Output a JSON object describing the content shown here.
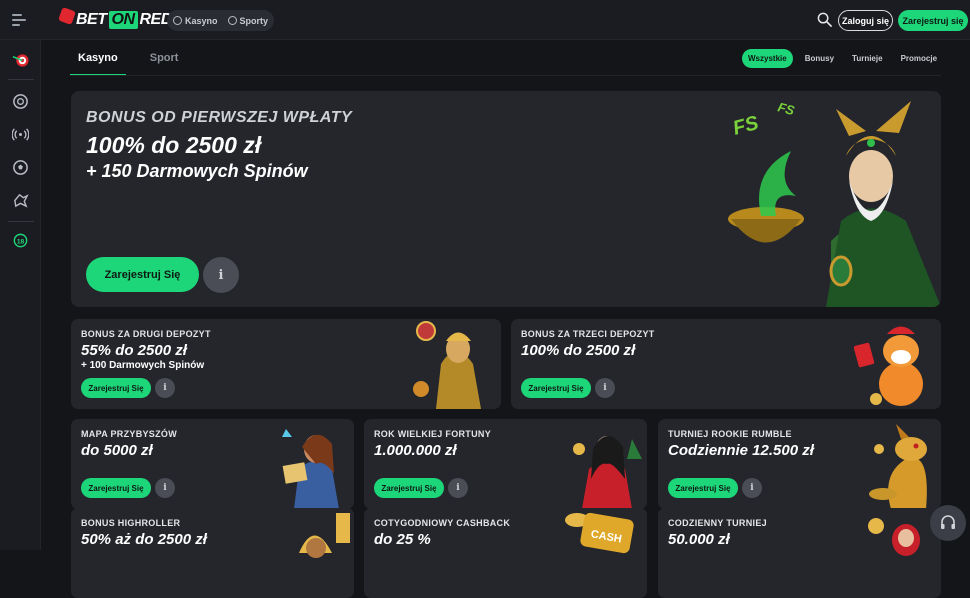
{
  "header": {
    "brand_left": "BET",
    "brand_mid": "ON",
    "brand_right": "RED",
    "nav": [
      {
        "label": "Kasyno",
        "icon": "casino-chip-icon"
      },
      {
        "label": "Sporty",
        "icon": "soccer-ball-icon"
      }
    ],
    "login_label": "Zaloguj się",
    "register_label": "Zarejestruj się"
  },
  "sidebar": {
    "icons": [
      "dart-target-icon",
      "casino-chip-icon",
      "live-broadcast-icon",
      "soccer-ball-icon",
      "esports-icon",
      "responsible-gaming-icon"
    ]
  },
  "tabs": [
    {
      "label": "Kasyno",
      "active": true
    },
    {
      "label": "Sport",
      "active": false
    }
  ],
  "filters": [
    {
      "label": "Wszystkie",
      "active": true
    },
    {
      "label": "Bonusy",
      "active": false
    },
    {
      "label": "Turnieje",
      "active": false
    },
    {
      "label": "Promocje",
      "active": false
    }
  ],
  "hero": {
    "title": "BONUS OD PIERWSZEJ WPŁATY",
    "amount": "100% do 2500 zł",
    "extra": "+ 150 Darmowych Spinów",
    "cta": "Zarejestruj Się",
    "info": "i"
  },
  "cards": [
    {
      "title": "BONUS ZA DRUGI DEPOZYT",
      "value": "55% do 2500 zł",
      "sub": "+ 100 Darmowych Spinów",
      "cta": "Zarejestruj Się",
      "info": "i"
    },
    {
      "title": "BONUS ZA TRZECI DEPOZYT",
      "value": "100% do 2500 zł",
      "sub": "",
      "cta": "Zarejestruj Się",
      "info": "i"
    },
    {
      "title": "MAPA PRZYBYSZÓW",
      "value": "do 5000 zł",
      "sub": "",
      "cta": "Zarejestruj Się",
      "info": "i"
    },
    {
      "title": "ROK WIELKIEJ FORTUNY",
      "value": "1.000.000 zł",
      "sub": "",
      "cta": "Zarejestruj Się",
      "info": "i"
    },
    {
      "title": "TURNIEJ ROOKIE RUMBLE",
      "value": "Codziennie 12.500 zł",
      "sub": "",
      "cta": "Zarejestruj Się",
      "info": "i"
    },
    {
      "title": "BONUS HIGHROLLER",
      "value": "50% aż do 2500 zł",
      "sub": "",
      "cta": "",
      "info": ""
    },
    {
      "title": "COTYGODNIOWY CASHBACK",
      "value": "do 25 %",
      "sub": "",
      "cta": "",
      "info": ""
    },
    {
      "title": "CODZIENNY TURNIEJ",
      "value": "50.000 zł",
      "sub": "",
      "cta": "",
      "info": ""
    }
  ],
  "colors": {
    "accent": "#1ed67a",
    "background": "#141519",
    "card": "#24262c",
    "brand_red": "#e0262f"
  }
}
